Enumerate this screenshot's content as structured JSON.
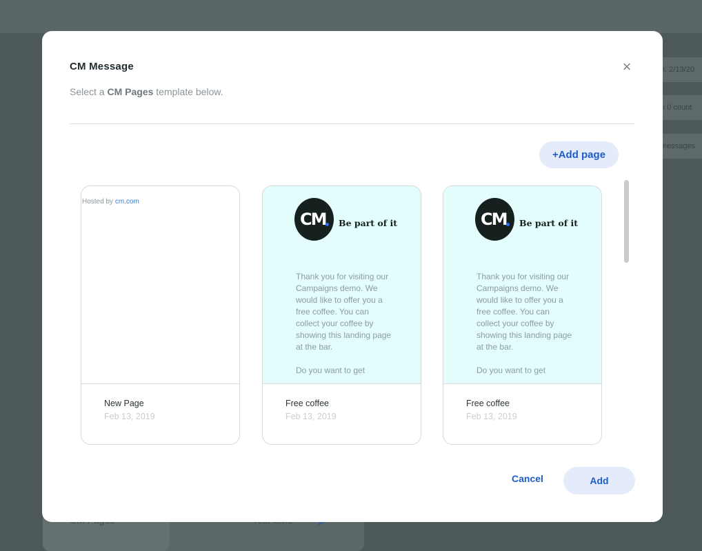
{
  "background": {
    "card_label_left": "CM Pages",
    "card_label_right": "Test SMS",
    "chips": [
      "n: 2/13/20",
      "n 0 count",
      "messages"
    ]
  },
  "modal": {
    "title": "CM Message",
    "subtitle_prefix": "Select a ",
    "subtitle_bold": "CM Pages",
    "subtitle_suffix": " template below.",
    "close_icon": "×",
    "add_page_label": "+Add page",
    "cancel_label": "Cancel",
    "add_label": "Add",
    "accent_color": "#1f5cc8"
  },
  "cards": [
    {
      "title": "New Page",
      "date": "Feb 13, 2019",
      "hosted_prefix": "Hosted by ",
      "hosted_link": "cm.com"
    },
    {
      "title": "Free coffee",
      "date": "Feb 13, 2019",
      "logo_text": "CM",
      "tagline": "Be part of it",
      "body": "Thank you for visiting our Campaigns demo. We would like to offer you a free coffee. You can collect your coffee by showing this landing page at the bar.",
      "body_more": "Do you want to get"
    },
    {
      "title": "Free coffee",
      "date": "Feb 13, 2019",
      "logo_text": "CM",
      "tagline": "Be part of it",
      "body": "Thank you for visiting our Campaigns demo. We would like to offer you a free coffee. You can collect your coffee by showing this landing page at the bar.",
      "body_more": "Do you want to get"
    }
  ]
}
